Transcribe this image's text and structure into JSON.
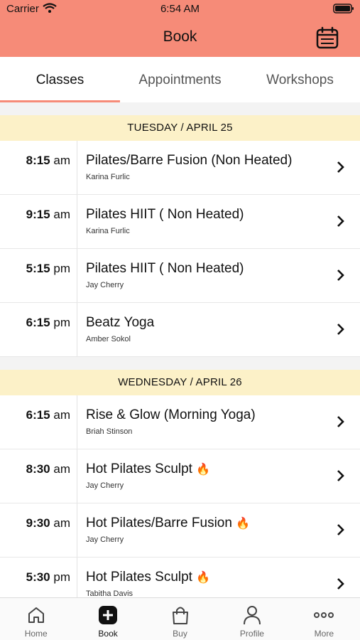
{
  "status_bar": {
    "carrier": "Carrier",
    "time": "6:54 AM"
  },
  "header": {
    "title": "Book"
  },
  "tabs": [
    {
      "label": "Classes",
      "active": true
    },
    {
      "label": "Appointments",
      "active": false
    },
    {
      "label": "Workshops",
      "active": false
    }
  ],
  "days": [
    {
      "date": "TUESDAY / APRIL 25",
      "classes": [
        {
          "time": "8:15",
          "ampm": "am",
          "name": "Pilates/Barre Fusion (Non Heated)",
          "instructor": "Karina Furlic"
        },
        {
          "time": "9:15",
          "ampm": "am",
          "name": "Pilates HIIT ( Non Heated)",
          "instructor": "Karina Furlic"
        },
        {
          "time": "5:15",
          "ampm": "pm",
          "name": "Pilates HIIT ( Non Heated)",
          "instructor": "Jay Cherry"
        },
        {
          "time": "6:15",
          "ampm": "pm",
          "name": "Beatz Yoga",
          "instructor": "Amber Sokol"
        }
      ]
    },
    {
      "date": "WEDNESDAY / APRIL 26",
      "classes": [
        {
          "time": "6:15",
          "ampm": "am",
          "name": "Rise & Glow (Morning Yoga)",
          "instructor": "Briah Stinson"
        },
        {
          "time": "8:30",
          "ampm": "am",
          "name": "Hot Pilates Sculpt",
          "instructor": "Jay Cherry",
          "hot": true
        },
        {
          "time": "9:30",
          "ampm": "am",
          "name": "Hot Pilates/Barre Fusion",
          "instructor": "Jay Cherry",
          "hot": true
        },
        {
          "time": "5:30",
          "ampm": "pm",
          "name": "Hot Pilates Sculpt",
          "instructor": "Tabitha Davis",
          "hot": true
        }
      ]
    }
  ],
  "tabbar": [
    {
      "label": "Home",
      "icon": "home-icon"
    },
    {
      "label": "Book",
      "icon": "plus-square-icon",
      "active": true
    },
    {
      "label": "Buy",
      "icon": "shopping-bag-icon"
    },
    {
      "label": "Profile",
      "icon": "user-icon"
    },
    {
      "label": "More",
      "icon": "more-dots-icon"
    }
  ],
  "colors": {
    "header": "#f68b78",
    "day_header": "#fcf1c8",
    "accent": "#f68b78"
  }
}
